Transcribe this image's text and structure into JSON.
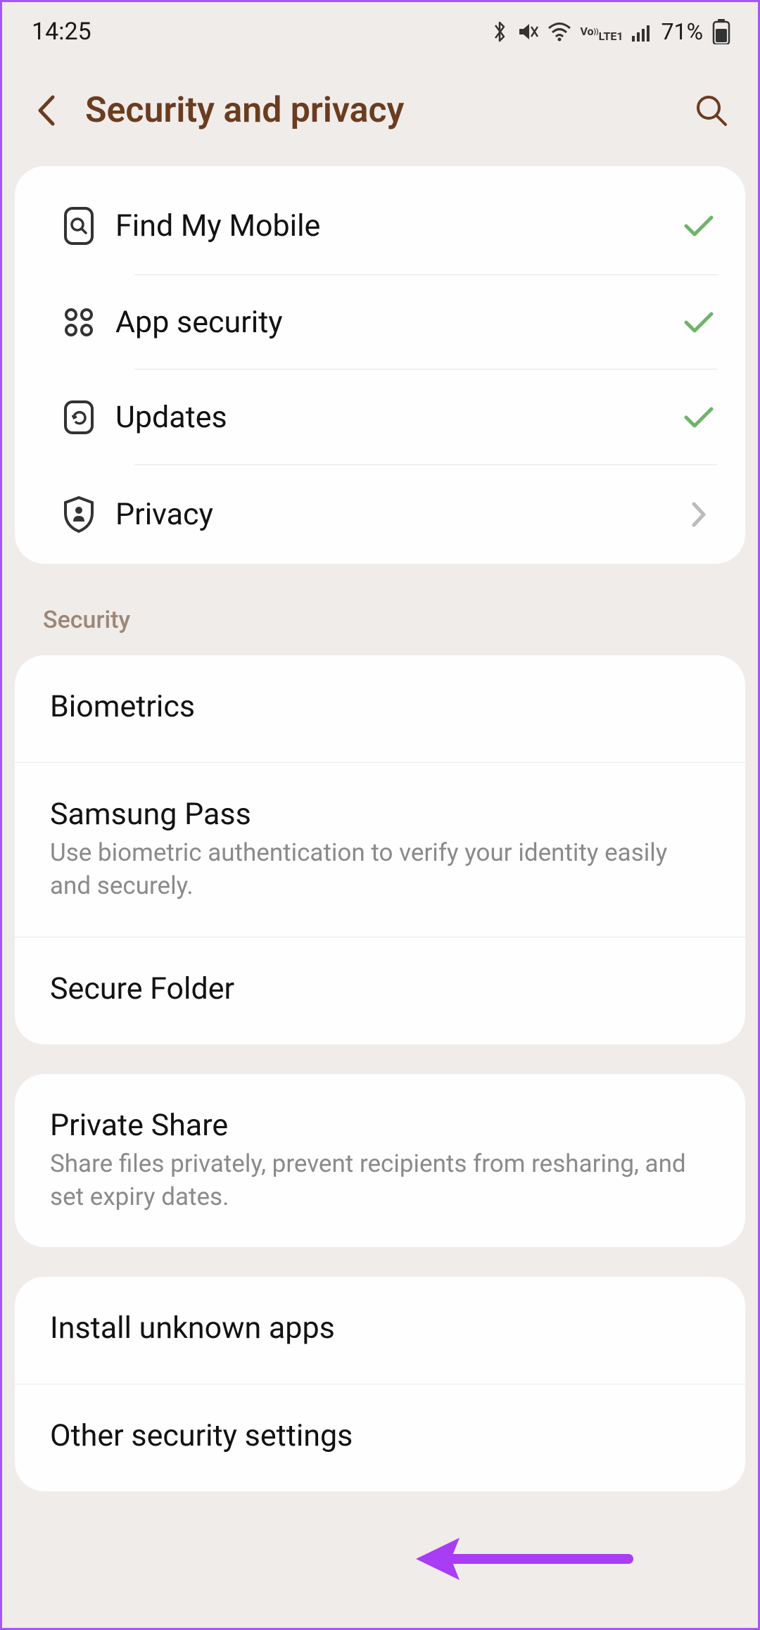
{
  "status_bar": {
    "time": "14:25",
    "battery_percent": "71%"
  },
  "header": {
    "title": "Security and privacy"
  },
  "quick_items": [
    {
      "label": "Find My Mobile",
      "icon": "search-device",
      "status": "check"
    },
    {
      "label": "App security",
      "icon": "apps-grid",
      "status": "check"
    },
    {
      "label": "Updates",
      "icon": "refresh",
      "status": "check"
    },
    {
      "label": "Privacy",
      "icon": "shield-user",
      "status": "chevron"
    }
  ],
  "section_label": "Security",
  "security_items": [
    {
      "title": "Biometrics",
      "subtitle": ""
    },
    {
      "title": "Samsung Pass",
      "subtitle": "Use biometric authentication to verify your identity easily and securely."
    },
    {
      "title": "Secure Folder",
      "subtitle": ""
    }
  ],
  "share_items": [
    {
      "title": "Private Share",
      "subtitle": "Share files privately, prevent recipients from resharing, and set expiry dates."
    }
  ],
  "other_items": [
    {
      "title": "Install unknown apps",
      "subtitle": ""
    },
    {
      "title": "Other security settings",
      "subtitle": ""
    }
  ]
}
